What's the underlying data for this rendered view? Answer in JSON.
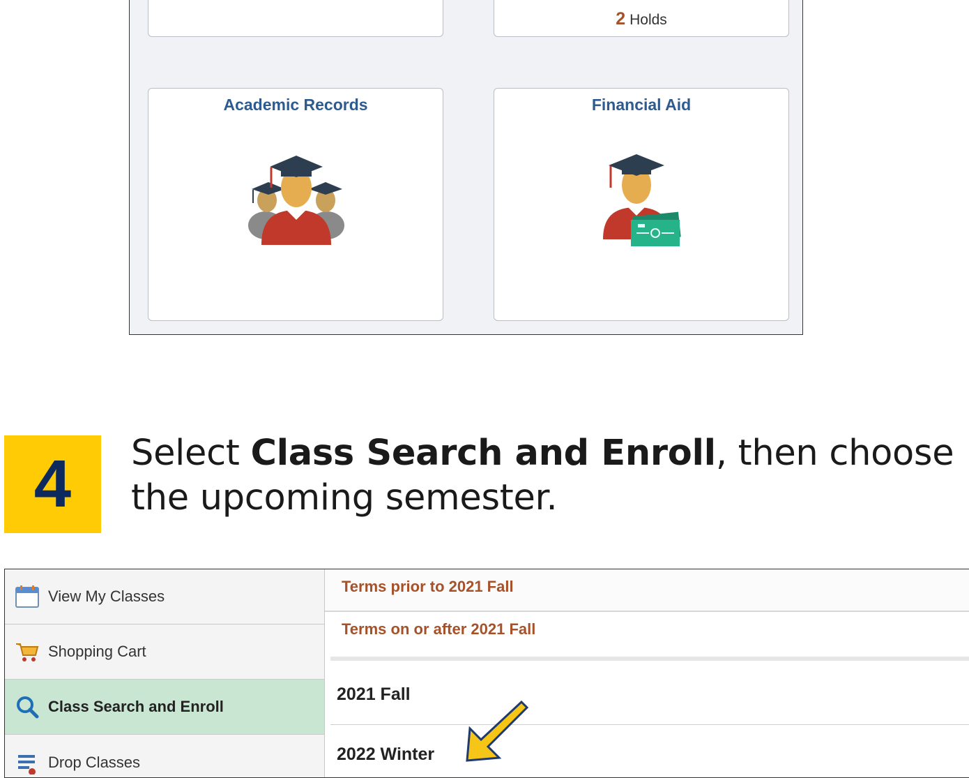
{
  "top_screenshot": {
    "holds_tile": {
      "count": "2",
      "label": "Holds"
    },
    "academic_records_tile": {
      "title": "Academic Records"
    },
    "financial_aid_tile": {
      "title": "Financial Aid"
    }
  },
  "step": {
    "number": "4",
    "text_before": "Select ",
    "text_bold": "Class Search and Enroll",
    "text_after": ", then choose the upcoming semester."
  },
  "bottom_screenshot": {
    "nav_items": [
      {
        "label": "View My Classes",
        "icon": "calendar-icon"
      },
      {
        "label": "Shopping Cart",
        "icon": "shopping-cart-icon"
      },
      {
        "label": "Class Search and Enroll",
        "icon": "search-icon",
        "active": true
      },
      {
        "label": "Drop Classes",
        "icon": "drop-classes-icon"
      }
    ],
    "term_headers": [
      "Terms prior to 2021 Fall",
      "Terms on or after 2021 Fall"
    ],
    "terms": [
      "2021 Fall",
      "2022 Winter"
    ],
    "colors": {
      "accent_header": "#a5522a",
      "active_nav": "#c9e6d3",
      "step_badge": "#ffcb05",
      "arrow": "#f5c518"
    }
  }
}
